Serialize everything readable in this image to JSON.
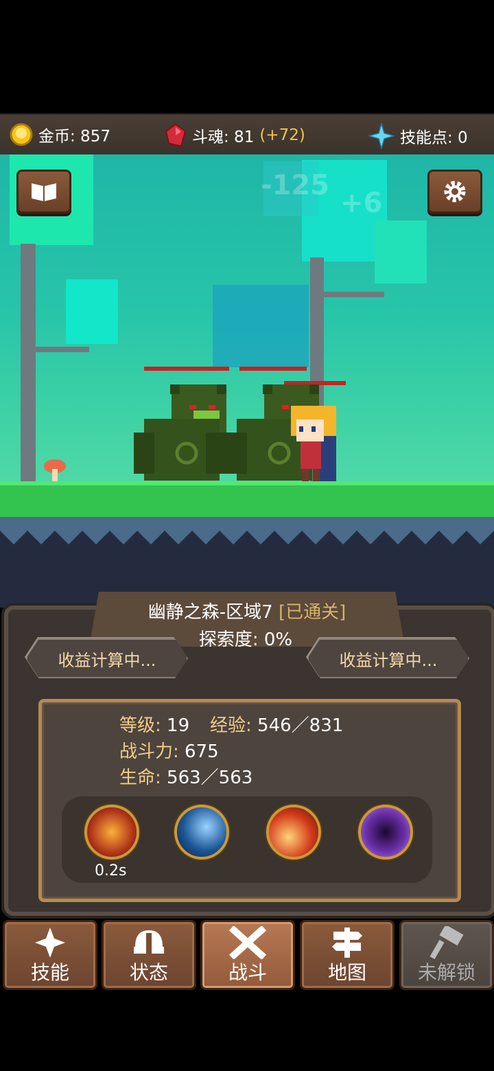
{
  "topbar": {
    "gold_label": "金币: 857",
    "soul_label": "斗魂: 81",
    "soul_bonus": "(+72)",
    "skill_points_label": "技能点: 0"
  },
  "scene": {
    "damage_number": "-125",
    "heal_number": "+6",
    "enemy_hp_fractions": [
      1.0,
      1.0
    ],
    "hero_hp_fraction": 1.0
  },
  "zone": {
    "name": "幽静之森-区域7",
    "status": "[已通关]",
    "exploration": "探索度: 0%",
    "income_left": "收益计算中...",
    "income_right": "收益计算中..."
  },
  "stats": {
    "level_key": "等级:",
    "level_val": "19",
    "exp_key": "经验:",
    "exp_val": "546／831",
    "power_key": "战斗力:",
    "power_val": "675",
    "hp_key": "生命:",
    "hp_val": "563／563"
  },
  "skills": [
    {
      "name": "fire-skill-icon",
      "cooldown": "0.2s",
      "color": "#d4521b"
    },
    {
      "name": "ice-slash-skill-icon",
      "cooldown": "",
      "color": "#2d6fb0"
    },
    {
      "name": "flame-slash-skill-icon",
      "cooldown": "",
      "color": "#d2401c"
    },
    {
      "name": "vortex-skill-icon",
      "cooldown": "",
      "color": "#6a2fa6"
    }
  ],
  "nav": [
    {
      "label": "技能",
      "icon": "sparkle-icon"
    },
    {
      "label": "状态",
      "icon": "helmet-icon"
    },
    {
      "label": "战斗",
      "icon": "crossed-swords-icon",
      "active": true
    },
    {
      "label": "地图",
      "icon": "signpost-icon"
    },
    {
      "label": "未解锁",
      "icon": "hammer-icon",
      "locked": true
    }
  ]
}
